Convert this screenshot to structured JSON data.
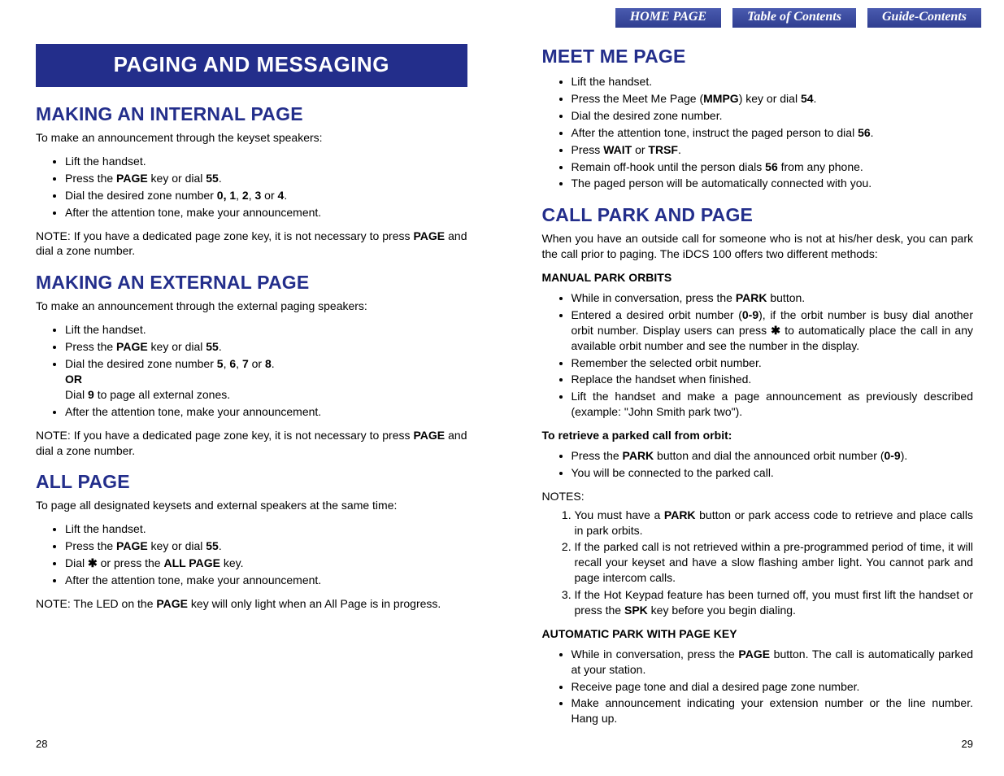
{
  "nav": {
    "home": "HOME PAGE",
    "toc": "Table of Contents",
    "guide": "Guide-Contents"
  },
  "left": {
    "banner": "PAGING AND MESSAGING",
    "sec1": {
      "title": "MAKING AN INTERNAL PAGE",
      "intro": "To make an announcement through the keyset speakers:",
      "b1": "Lift the handset.",
      "b2a": "Press the ",
      "b2b": "PAGE",
      "b2c": " key or dial ",
      "b2d": "55",
      "b2e": ".",
      "b3a": "Dial the desired zone number ",
      "b3b": "0, 1",
      "b3c": ", ",
      "b3d": "2",
      "b3e": ", ",
      "b3f": "3",
      "b3g": " or ",
      "b3h": "4",
      "b3i": ".",
      "b4": "After the attention tone, make your announcement.",
      "n1a": "NOTE: If you have a dedicated page zone key, it is not necessary to press ",
      "n1b": "PAGE",
      "n1c": " and dial a zone number."
    },
    "sec2": {
      "title": "MAKING AN EXTERNAL PAGE",
      "intro": "To make an announcement through the external paging speakers:",
      "b1": "Lift the handset.",
      "b2a": "Press the ",
      "b2b": "PAGE",
      "b2c": " key or dial ",
      "b2d": "55",
      "b2e": ".",
      "b3a": "Dial the desired zone number ",
      "b3b": "5",
      "b3c": ", ",
      "b3d": "6",
      "b3e": ", ",
      "b3f": "7",
      "b3g": " or ",
      "b3h": "8",
      "b3i": ".",
      "b3or": "OR",
      "b3j": "Dial ",
      "b3k": "9",
      "b3l": " to page all external zones.",
      "b4": "After the attention tone, make your announcement.",
      "n1a": "NOTE: If you have a dedicated page zone key, it is not necessary to press ",
      "n1b": "PAGE",
      "n1c": " and dial a zone number."
    },
    "sec3": {
      "title": "ALL PAGE",
      "intro": "To page all designated keysets and external speakers at the same time:",
      "b1": "Lift the handset.",
      "b2a": "Press the ",
      "b2b": "PAGE",
      "b2c": " key or dial ",
      "b2d": "55",
      "b2e": ".",
      "b3a": "Dial ",
      "b3b": "✱",
      "b3c": " or press the ",
      "b3d": "ALL PAGE",
      "b3e": " key.",
      "b4": "After the attention tone, make your announcement.",
      "n1a": "NOTE: The LED on the ",
      "n1b": "PAGE",
      "n1c": " key will only light when an All Page is in progress."
    }
  },
  "right": {
    "sec4": {
      "title": "MEET ME PAGE",
      "b1": "Lift the handset.",
      "b2a": "Press the Meet Me Page (",
      "b2b": "MMPG",
      "b2c": ") key or dial ",
      "b2d": "54",
      "b2e": ".",
      "b3": "Dial the desired zone number.",
      "b4a": "After the attention tone, instruct the paged person to dial ",
      "b4b": "56",
      "b4c": ".",
      "b5a": "Press ",
      "b5b": "WAIT",
      "b5c": " or ",
      "b5d": "TRSF",
      "b5e": ".",
      "b6a": "Remain off-hook until the person dials ",
      "b6b": "56",
      "b6c": " from any phone.",
      "b7": "The paged person will be automatically connected with you."
    },
    "sec5": {
      "title": "CALL PARK AND PAGE",
      "intro": "When you have an outside call for someone who is not at his/her desk, you can park the call prior to paging. The iDCS 100 offers two different methods:",
      "sub1": "MANUAL PARK ORBITS",
      "m1a": "While in conversation, press the ",
      "m1b": "PARK",
      "m1c": " button.",
      "m2a": "Entered a desired orbit number (",
      "m2b": "0-9",
      "m2c": "), if the orbit number is busy dial another orbit number. Display users can press ",
      "m2d": "✱",
      "m2e": " to automatically place the call in any available orbit number and see the number in the display.",
      "m3": "Remember the selected orbit number.",
      "m4": "Replace the handset when finished.",
      "m5": "Lift the handset and make a page announcement as previously described (example: \"John Smith park two\").",
      "sub2": "To retrieve a parked call from orbit:",
      "r1a": "Press the ",
      "r1b": "PARK",
      "r1c": " button and dial the announced orbit number (",
      "r1d": "0-9",
      "r1e": ").",
      "r2": "You will be connected to the parked call.",
      "notesLabel": "NOTES:",
      "n1a": "You must have a ",
      "n1b": "PARK",
      "n1c": " button or park access code to retrieve and place calls in park orbits.",
      "n2": "If the parked call is not retrieved within a pre-programmed period of time, it will recall your keyset and have a slow flashing amber light. You cannot park and page intercom calls.",
      "n3a": "If the Hot Keypad feature has been turned off, you must first lift the handset or press the ",
      "n3b": "SPK",
      "n3c": " key before you begin dialing.",
      "sub3": "AUTOMATIC PARK WITH PAGE KEY",
      "a1a": "While in conversation, press the ",
      "a1b": "PAGE",
      "a1c": " button. The call is automatically parked at your station.",
      "a2": "Receive page tone and dial a desired page zone number.",
      "a3": "Make announcement indicating your extension number or the line number. Hang up."
    }
  },
  "pages": {
    "left": "28",
    "right": "29"
  }
}
